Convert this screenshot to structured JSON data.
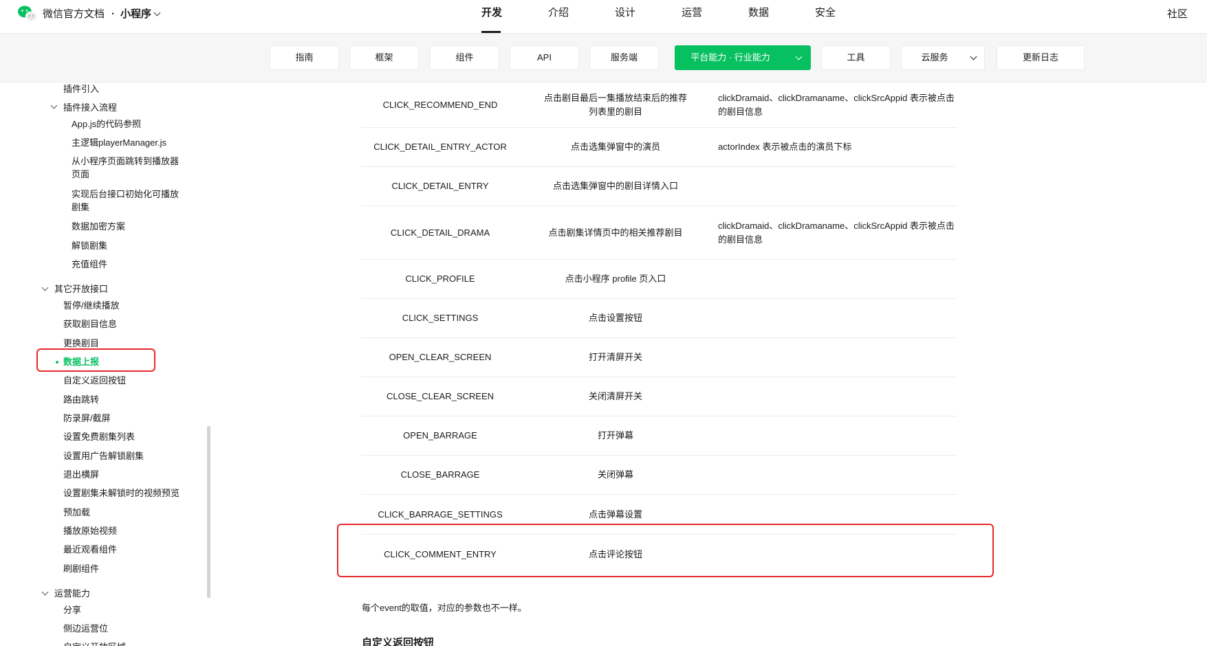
{
  "header": {
    "brand": "微信官方文档",
    "separator": "·",
    "product": "小程序",
    "nav": [
      "开发",
      "介绍",
      "设计",
      "运营",
      "数据",
      "安全"
    ],
    "active_nav": "开发",
    "community": "社区"
  },
  "subnav": {
    "items": [
      "指南",
      "框架",
      "组件",
      "API",
      "服务端",
      "平台能力 · 行业能力",
      "工具",
      "云服务",
      "更新日志"
    ],
    "active": "平台能力 · 行业能力"
  },
  "sidebar": {
    "items": [
      "插件引入",
      "插件接入流程",
      "App.js的代码参照",
      "主逻辑playerManager.js",
      "从小程序页面跳转到播放器页面",
      "实现后台接口初始化可播放剧集",
      "数据加密方案",
      "解锁剧集",
      "充值组件",
      "其它开放接口",
      "暂停/继续播放",
      "获取剧目信息",
      "更换剧目",
      "数据上报",
      "自定义返回按钮",
      "路由跳转",
      "防录屏/截屏",
      "设置免费剧集列表",
      "设置用广告解锁剧集",
      "退出横屏",
      "设置剧集未解锁时的视频预览",
      "预加载",
      "播放原始视频",
      "最近观看组件",
      "刷剧组件",
      "运营能力",
      "分享",
      "侧边运营位",
      "自定义开放区域"
    ],
    "active": "数据上报"
  },
  "table": {
    "rows": [
      {
        "event": "CLICK_RECOMMEND_END",
        "desc": "点击剧目最后一集播放结束后的推荐列表里的剧目",
        "params": "clickDramaid、clickDramaname、clickSrcAppid 表示被点击的剧目信息"
      },
      {
        "event": "CLICK_DETAIL_ENTRY_ACTOR",
        "desc": "点击选集弹窗中的演员",
        "params": "actorIndex 表示被点击的演员下标"
      },
      {
        "event": "CLICK_DETAIL_ENTRY",
        "desc": "点击选集弹窗中的剧目详情入口",
        "params": ""
      },
      {
        "event": "CLICK_DETAIL_DRAMA",
        "desc": "点击剧集详情页中的相关推荐剧目",
        "params": "clickDramaid、clickDramaname、clickSrcAppid 表示被点击的剧目信息"
      },
      {
        "event": "CLICK_PROFILE",
        "desc": "点击小程序 profile 页入口",
        "params": ""
      },
      {
        "event": "CLICK_SETTINGS",
        "desc": "点击设置按钮",
        "params": ""
      },
      {
        "event": "OPEN_CLEAR_SCREEN",
        "desc": "打开清屏开关",
        "params": ""
      },
      {
        "event": "CLOSE_CLEAR_SCREEN",
        "desc": "关闭清屏开关",
        "params": ""
      },
      {
        "event": "OPEN_BARRAGE",
        "desc": "打开弹幕",
        "params": ""
      },
      {
        "event": "CLOSE_BARRAGE",
        "desc": "关闭弹幕",
        "params": ""
      },
      {
        "event": "CLICK_BARRAGE_SETTINGS",
        "desc": "点击弹幕设置",
        "params": ""
      },
      {
        "event": "CLICK_COMMENT_ENTRY",
        "desc": "点击评论按钮",
        "params": ""
      }
    ]
  },
  "content": {
    "note": "每个event的取值，对应的参数也不一样。",
    "next_heading": "自定义返回按钮"
  },
  "colors": {
    "accent": "#07c160",
    "highlight": "#e8262a"
  }
}
